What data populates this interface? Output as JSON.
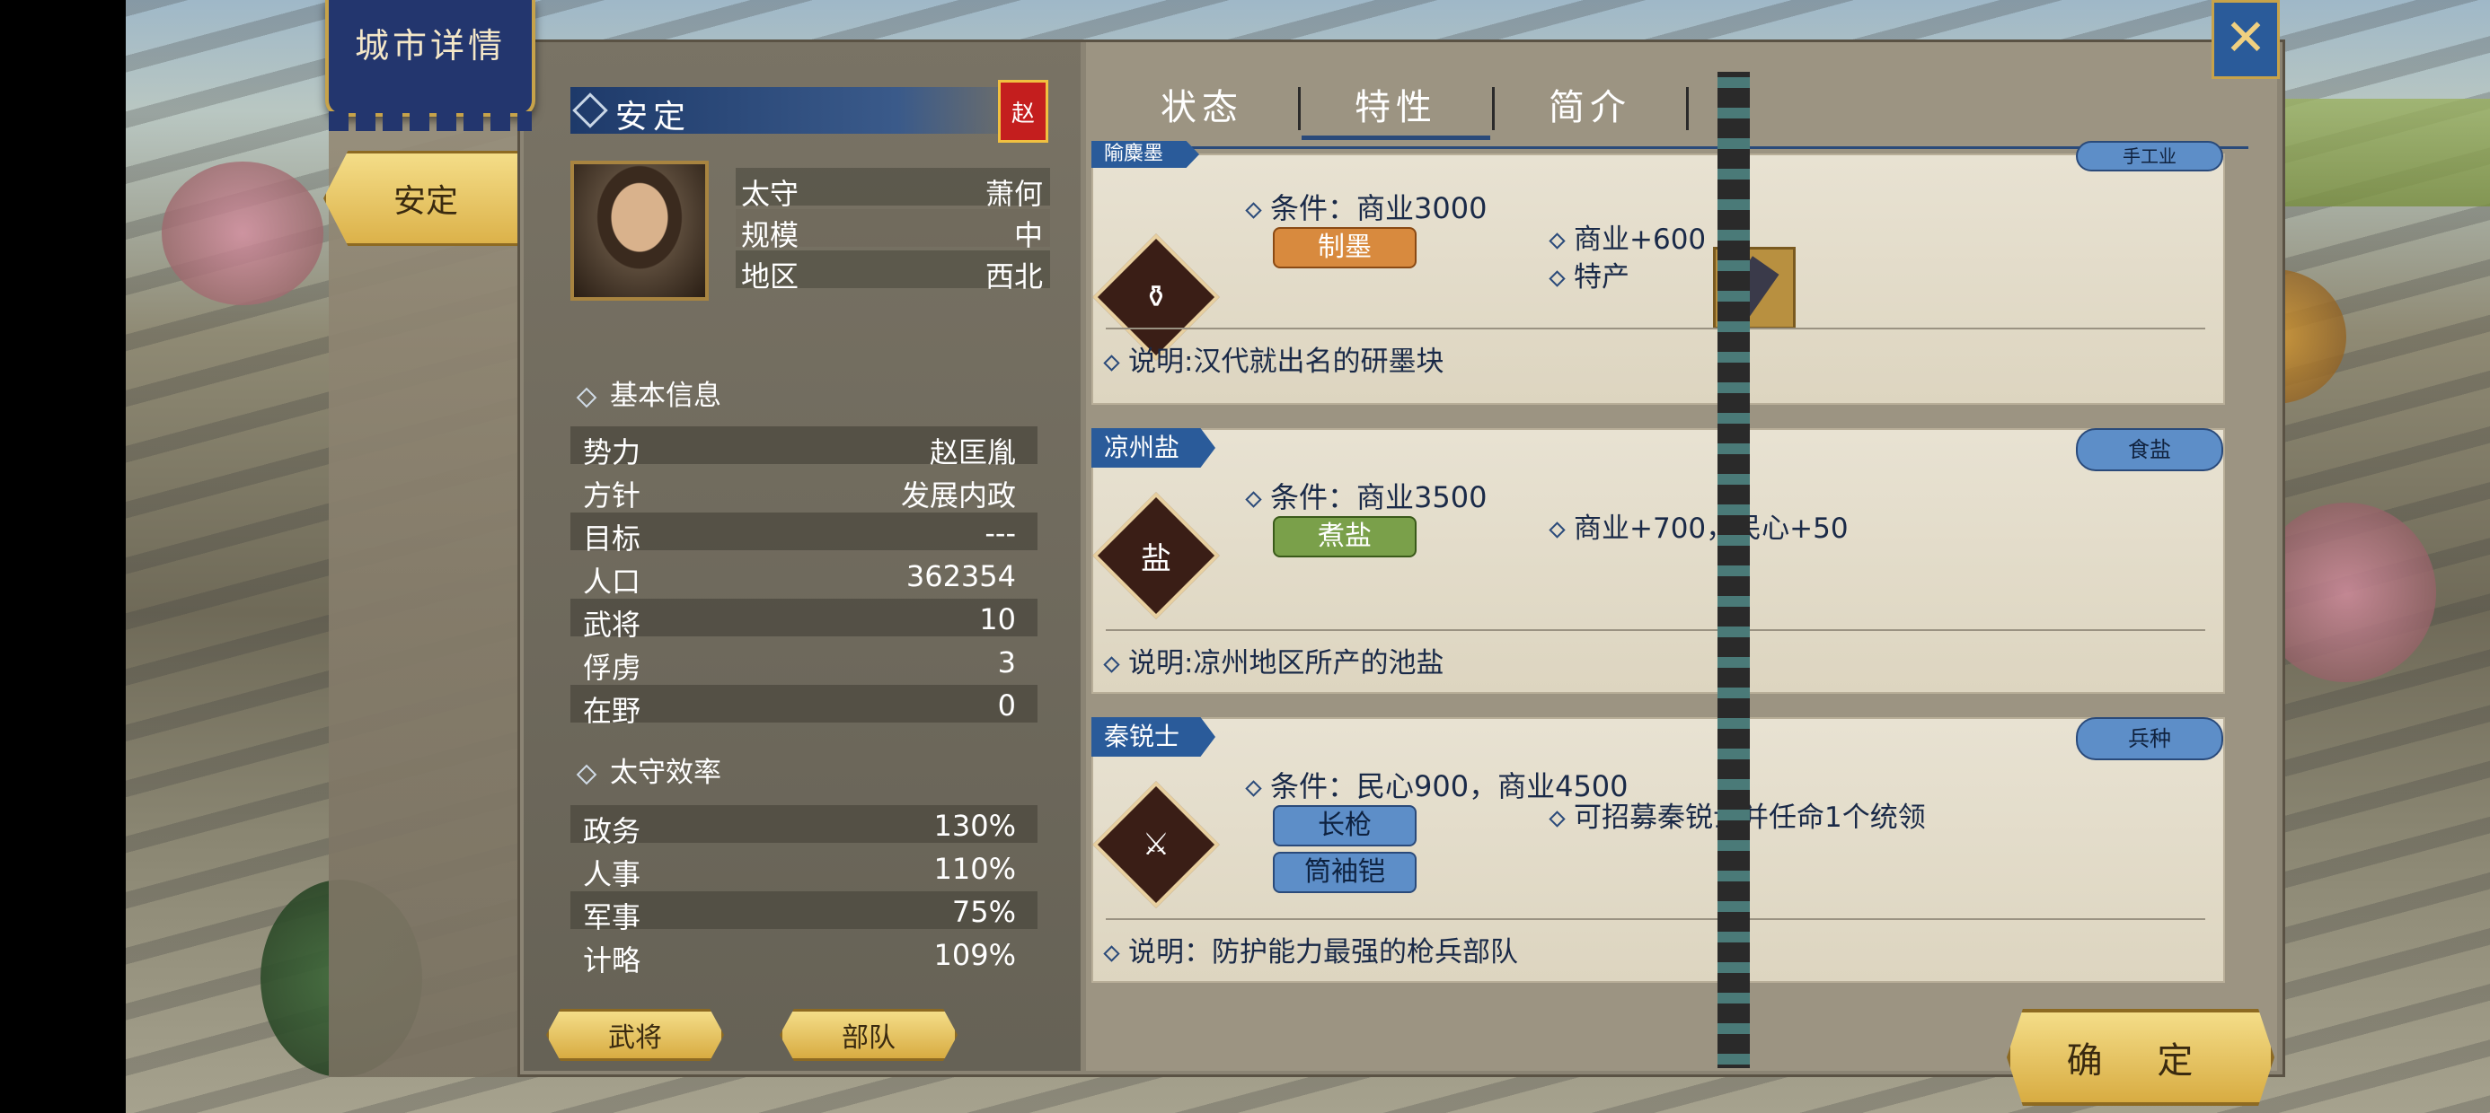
{
  "banner": {
    "title": "城市详情"
  },
  "sidebar": {
    "city_tab": "安定"
  },
  "city": {
    "name": "安定",
    "faction_flag": "赵",
    "governor_label": "太守",
    "governor": "萧何",
    "scale_label": "规模",
    "scale": "中",
    "region_label": "地区",
    "region": "西北"
  },
  "basic_info": {
    "title": "基本信息",
    "rows": [
      {
        "k": "势力",
        "v": "赵匡胤"
      },
      {
        "k": "方针",
        "v": "发展内政"
      },
      {
        "k": "目标",
        "v": "---"
      },
      {
        "k": "人口",
        "v": "362354"
      },
      {
        "k": "武将",
        "v": "10"
      },
      {
        "k": "俘虏",
        "v": "3"
      },
      {
        "k": "在野",
        "v": "0"
      }
    ]
  },
  "efficiency": {
    "title": "太守效率",
    "rows": [
      {
        "k": "政务",
        "v": "130%"
      },
      {
        "k": "人事",
        "v": "110%"
      },
      {
        "k": "军事",
        "v": "75%"
      },
      {
        "k": "计略",
        "v": "109%"
      }
    ]
  },
  "bottom_buttons": {
    "generals": "武将",
    "troops": "部队"
  },
  "tabs": [
    "状态",
    "特性",
    "简介"
  ],
  "active_tab": "特性",
  "cards": [
    {
      "tag": "隃麋墨",
      "category": "手工业",
      "condition": "条件：商业3000",
      "pill": "制墨",
      "effect1": "商业+600",
      "effect2": "特产",
      "description": "说明:汉代就出名的研墨块"
    },
    {
      "tag": "凉州盐",
      "category": "食盐",
      "condition": "条件：商业3500",
      "pill": "煮盐",
      "emblem_text": "盐",
      "effect1": "商业+700，民心+50",
      "description": "说明:凉州地区所产的池盐"
    },
    {
      "tag": "秦锐士",
      "category": "兵种",
      "condition": "条件：民心900，商业4500",
      "pill1": "长枪",
      "pill2": "筒袖铠",
      "effect1": "可招募秦锐士并任命1个统领",
      "description": "说明：防护能力最强的枪兵部队"
    }
  ],
  "confirm_button": "确 定",
  "close_icon": "close-icon",
  "colors": {
    "accent_blue": "#2a5b9a",
    "gold": "#d8ac42",
    "faction_red": "#c41e1e"
  }
}
